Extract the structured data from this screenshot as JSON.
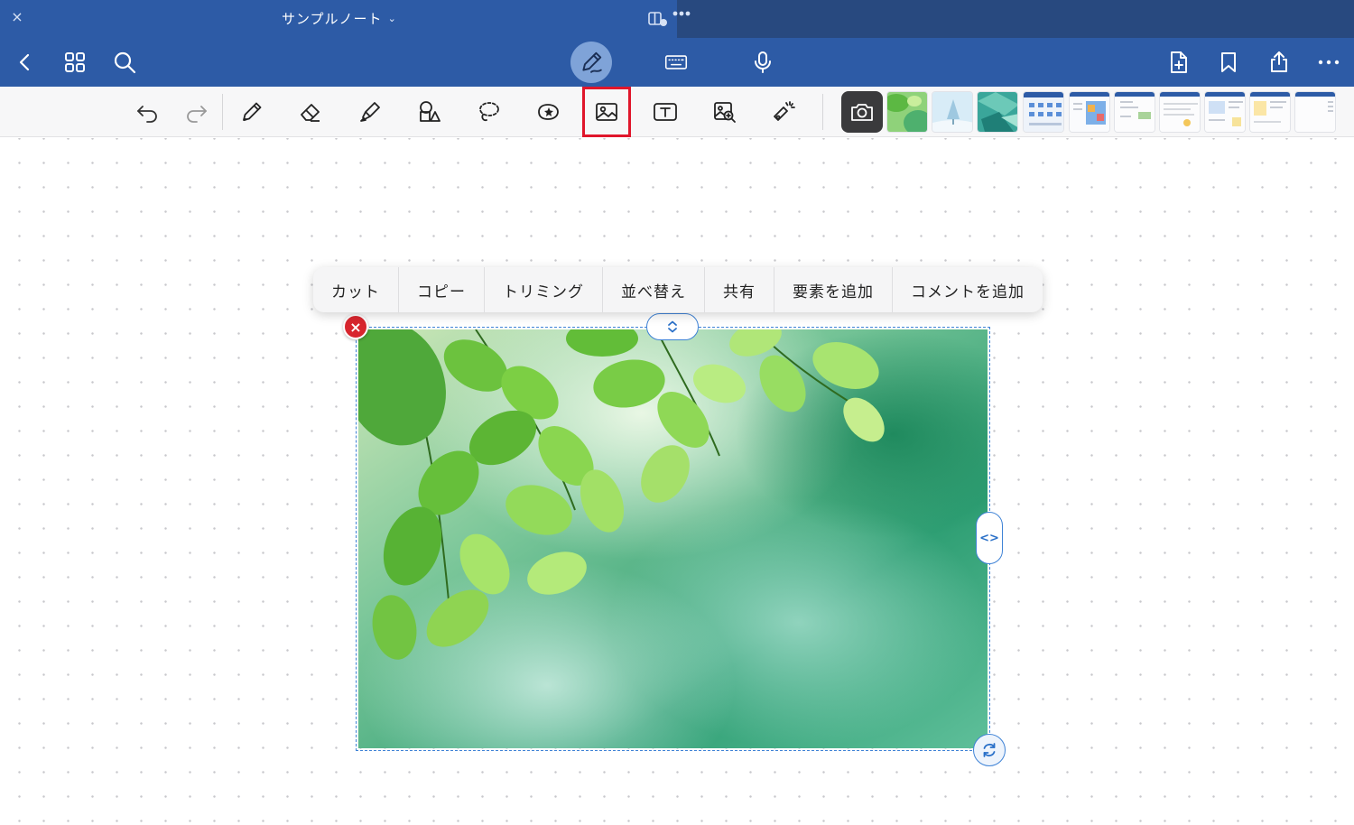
{
  "window": {
    "close_glyph": "×",
    "title": "サンプルノート",
    "title_chevron": "⌄"
  },
  "navbar": {
    "left": [
      "back-icon",
      "grid-icon",
      "search-icon"
    ],
    "center": [
      "pen-mode-icon",
      "keyboard-icon",
      "microphone-icon"
    ],
    "right": [
      "add-page-icon",
      "bookmark-icon",
      "share-icon",
      "more-icon"
    ]
  },
  "toolbar": {
    "tools": [
      "undo-icon",
      "redo-icon",
      "pencil-icon",
      "eraser-icon",
      "highlighter-icon",
      "shapes-icon",
      "lasso-icon",
      "sticker-icon",
      "image-icon",
      "textbox-icon",
      "image-search-icon",
      "laser-pointer-icon"
    ],
    "selected_tool": "image-icon",
    "camera": "camera-icon",
    "thumbnail_count": 10
  },
  "context_menu": {
    "items": [
      "カット",
      "コピー",
      "トリミング",
      "並べ替え",
      "共有",
      "要素を追加",
      "コメントを追加"
    ]
  },
  "selection": {
    "delete_glyph": "×",
    "resize_right_glyph": "<>"
  },
  "colors": {
    "header": "#2d5ba6",
    "header_dark": "#28497f",
    "selection": "#3f83d6",
    "highlight": "#e0162b",
    "delete": "#d8262e"
  }
}
